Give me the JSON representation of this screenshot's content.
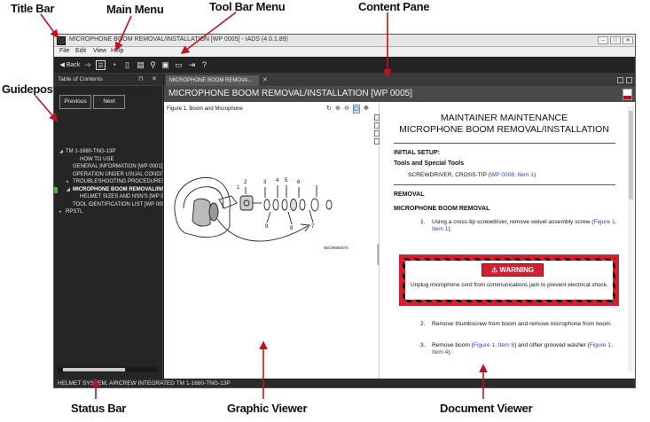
{
  "callouts": {
    "title_bar": "Title Bar",
    "main_menu": "Main Menu",
    "tool_bar_menu": "Tool Bar Menu",
    "content_pane": "Content Pane",
    "guidepost": "Guidepost",
    "status_bar": "Status Bar",
    "graphic_viewer": "Graphic Viewer",
    "document_viewer": "Document Viewer"
  },
  "window": {
    "title": "MICROPHONE BOOM REMOVAL/INSTALLATION [WP 0005] - IADS (4.0.1.89)",
    "minimize": "–",
    "maximize": "□",
    "close": "✕"
  },
  "menu": {
    "items": [
      "File",
      "Edit",
      "View",
      "Help"
    ]
  },
  "toolbar": {
    "back_label": "◀ Back",
    "forward_glyph": "➔",
    "icons": [
      "toc-icon",
      "history-icon",
      "bookmark-icon",
      "notes-icon",
      "search-icon",
      "print-icon",
      "comment-icon",
      "exit-icon",
      "help-icon"
    ]
  },
  "sidebar": {
    "title": "Table of Contents",
    "pin_glyph": "⊓",
    "close_glyph": "✕",
    "previous_label": "Previous",
    "next_label": "Next",
    "toc": [
      {
        "arrow": "◢",
        "indent": 0,
        "label": "TM 1-1680-TNG-13P",
        "selected": false
      },
      {
        "arrow": "",
        "indent": 2,
        "label": "HOW TO USE",
        "selected": false
      },
      {
        "arrow": "",
        "indent": 1,
        "label": "GENERAL INFORMATION [WP 0001]",
        "selected": false
      },
      {
        "arrow": "",
        "indent": 1,
        "label": "OPERATION UNDER USUAL CONDITIONS",
        "selected": false
      },
      {
        "arrow": "▸",
        "indent": 1,
        "label": "TROUBLESHOOTING PROCEDURES [WP 0(",
        "selected": false
      },
      {
        "arrow": "◢",
        "indent": 1,
        "label": "MICROPHONE BOOM REMOVAL/INSTAL",
        "selected": true
      },
      {
        "arrow": "",
        "indent": 2,
        "label": "HELMET SIZES AND NSN'S [WP 0007]",
        "selected": false
      },
      {
        "arrow": "",
        "indent": 1,
        "label": "TOOL IDENTIFICATION LIST [WP 0008]",
        "selected": false
      },
      {
        "arrow": "▸",
        "indent": 0,
        "label": "RPSTL",
        "selected": false
      }
    ]
  },
  "document": {
    "tab_label": "MICROPHONE BOOM REMOVA...",
    "tab_close": "✕",
    "header_title": "MICROPHONE BOOM REMOVAL/INSTALLATION [WP 0005]"
  },
  "graphic_viewer": {
    "figure_title": "Figure 1. Boom and Microphone",
    "tool_glyphs": [
      "↻",
      "⊕",
      "⊖",
      "⊡",
      "✥"
    ],
    "callout_numbers": [
      "1",
      "2",
      "3",
      "4",
      "5",
      "6",
      "7",
      "8",
      "9"
    ],
    "figure_code": "NEO0805STA"
  },
  "document_viewer": {
    "heading_line1": "MAINTAINER MAINTENANCE",
    "heading_line2": "MICROPHONE BOOM REMOVAL/INSTALLATION",
    "initial_setup": "INITIAL SETUP:",
    "tools_heading": "Tools and Special Tools",
    "tool_item_text": "SCREWDRIVER, CROSS-TIP (",
    "tool_item_link": "WP 0008, Item 1",
    "tool_item_end": ")",
    "removal": "REMOVAL",
    "boom_removal": "MICROPHONE BOOM REMOVAL",
    "step1_num": "1.",
    "step1_text": "Using a cross-tip screwdriver, remove swivel assembly screw (",
    "step1_link": "Figure 1, Item 1",
    "step1_end": ").",
    "warning_label": "WARNING",
    "warning_text": "Unplug microphone cord from communications jack to prevent electrical shock.",
    "step2_num": "2.",
    "step2_text": "Remove thumbscrew from boom and remove microphone from boom.",
    "step3_num": "3.",
    "step3_text_a": "Remove boom (",
    "step3_link_a": "Figure 1, Item 8",
    "step3_text_b": ") and other grooved washer (",
    "step3_link_b": "Figure 1, Item 4",
    "step3_end": ")."
  },
  "statusbar": {
    "text": "HELMET SYSTEM, AIRCREW INTEGRATED TM 1-1680-TNG-13P"
  },
  "colors": {
    "app_dark": "#1e1e1e",
    "selection_mark": "#3bbd3b",
    "warning_red": "#d31f2f",
    "link_blue": "#2a3fbf"
  }
}
